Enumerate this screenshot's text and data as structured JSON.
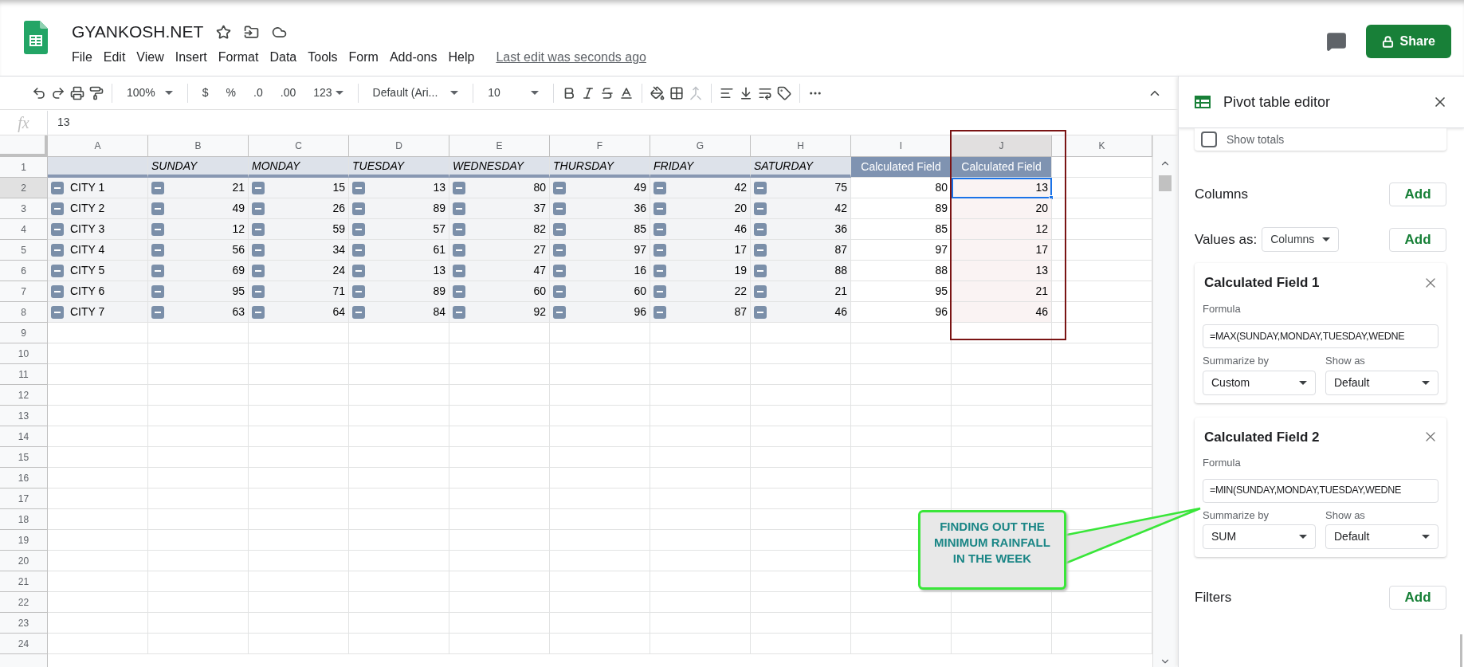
{
  "document": {
    "title": "GYANKOSH.NET",
    "last_edit": "Last edit was seconds ago",
    "share": "Share"
  },
  "menu": [
    "File",
    "Edit",
    "View",
    "Insert",
    "Format",
    "Data",
    "Tools",
    "Form",
    "Add-ons",
    "Help"
  ],
  "toolbar": {
    "zoom": "100%",
    "currency": "$",
    "percent": "%",
    "decrease_decimal": ".0",
    "increase_decimal": ".00",
    "more_formats": "123",
    "font": "Default (Ari...",
    "font_size": "10"
  },
  "formula_bar": {
    "label": "fx",
    "value": "13"
  },
  "sheet": {
    "columns": [
      {
        "label": "A",
        "selected": false
      },
      {
        "label": "B",
        "selected": false
      },
      {
        "label": "C",
        "selected": false
      },
      {
        "label": "D",
        "selected": false
      },
      {
        "label": "E",
        "selected": false
      },
      {
        "label": "F",
        "selected": false
      },
      {
        "label": "G",
        "selected": false
      },
      {
        "label": "H",
        "selected": false
      },
      {
        "label": "I",
        "selected": false
      },
      {
        "label": "J",
        "selected": true
      },
      {
        "label": "K",
        "selected": false
      }
    ],
    "row_numbers": [
      {
        "label": "1",
        "selected": false
      },
      {
        "label": "2",
        "selected": true
      },
      {
        "label": "3",
        "selected": false
      },
      {
        "label": "4",
        "selected": false
      },
      {
        "label": "5",
        "selected": false
      },
      {
        "label": "6",
        "selected": false
      },
      {
        "label": "7",
        "selected": false
      },
      {
        "label": "8",
        "selected": false
      },
      {
        "label": "9",
        "selected": false
      },
      {
        "label": "10",
        "selected": false
      },
      {
        "label": "11",
        "selected": false
      },
      {
        "label": "12",
        "selected": false
      },
      {
        "label": "13",
        "selected": false
      },
      {
        "label": "14",
        "selected": false
      },
      {
        "label": "15",
        "selected": false
      },
      {
        "label": "16",
        "selected": false
      },
      {
        "label": "17",
        "selected": false
      },
      {
        "label": "18",
        "selected": false
      },
      {
        "label": "19",
        "selected": false
      },
      {
        "label": "20",
        "selected": false
      },
      {
        "label": "21",
        "selected": false
      },
      {
        "label": "22",
        "selected": false
      },
      {
        "label": "23",
        "selected": false
      },
      {
        "label": "24",
        "selected": false
      }
    ],
    "header_row": {
      "days": [
        "SUNDAY",
        "MONDAY",
        "TUESDAY",
        "WEDNESDAY",
        "THURSDAY",
        "FRIDAY",
        "SATURDAY"
      ],
      "calculated": [
        "Calculated Field",
        "Calculated Field"
      ]
    },
    "rows": [
      {
        "city": "CITY 1",
        "days": [
          "21",
          "15",
          "13",
          "80",
          "49",
          "42",
          "75"
        ],
        "calculated": [
          {
            "value": "80",
            "selected": false
          },
          {
            "value": "13",
            "selected": true
          }
        ]
      },
      {
        "city": "CITY 2",
        "days": [
          "49",
          "26",
          "89",
          "37",
          "36",
          "20",
          "42"
        ],
        "calculated": [
          {
            "value": "89",
            "selected": false
          },
          {
            "value": "20",
            "selected": false
          }
        ]
      },
      {
        "city": "CITY 3",
        "days": [
          "12",
          "59",
          "57",
          "82",
          "85",
          "46",
          "36"
        ],
        "calculated": [
          {
            "value": "85",
            "selected": false
          },
          {
            "value": "12",
            "selected": false
          }
        ]
      },
      {
        "city": "CITY 4",
        "days": [
          "56",
          "34",
          "61",
          "27",
          "97",
          "17",
          "87"
        ],
        "calculated": [
          {
            "value": "97",
            "selected": false
          },
          {
            "value": "17",
            "selected": false
          }
        ]
      },
      {
        "city": "CITY 5",
        "days": [
          "69",
          "24",
          "13",
          "47",
          "16",
          "19",
          "88"
        ],
        "calculated": [
          {
            "value": "88",
            "selected": false
          },
          {
            "value": "13",
            "selected": false
          }
        ]
      },
      {
        "city": "CITY 6",
        "days": [
          "95",
          "71",
          "89",
          "60",
          "60",
          "22",
          "21"
        ],
        "calculated": [
          {
            "value": "95",
            "selected": false
          },
          {
            "value": "21",
            "selected": false
          }
        ]
      },
      {
        "city": "CITY 7",
        "days": [
          "63",
          "64",
          "84",
          "92",
          "96",
          "87",
          "46"
        ],
        "calculated": [
          {
            "value": "96",
            "selected": false
          },
          {
            "value": "46",
            "selected": false
          }
        ]
      }
    ]
  },
  "panel": {
    "title": "Pivot table editor",
    "show_totals": {
      "label": "Show totals",
      "checked": false
    },
    "columns_section": {
      "label": "Columns",
      "add": "Add"
    },
    "values_as": {
      "label": "Values as:",
      "option": "Columns",
      "add": "Add"
    },
    "calculated_fields": [
      {
        "title": "Calculated Field 1",
        "formula_label": "Formula",
        "formula": "=MAX(SUNDAY,MONDAY,TUESDAY,WEDNE",
        "summarize_label": "Summarize by",
        "summarize": "Custom",
        "show_as_label": "Show as",
        "show_as": "Default"
      },
      {
        "title": "Calculated Field 2",
        "formula_label": "Formula",
        "formula": "=MIN(SUNDAY,MONDAY,TUESDAY,WEDNE",
        "summarize_label": "Summarize by",
        "summarize": "SUM",
        "show_as_label": "Show as",
        "show_as": "Default"
      }
    ],
    "filters": {
      "label": "Filters",
      "add": "Add"
    }
  },
  "callout": {
    "text": "FINDING OUT THE MINIMUM RAINFALL IN THE WEEK"
  }
}
